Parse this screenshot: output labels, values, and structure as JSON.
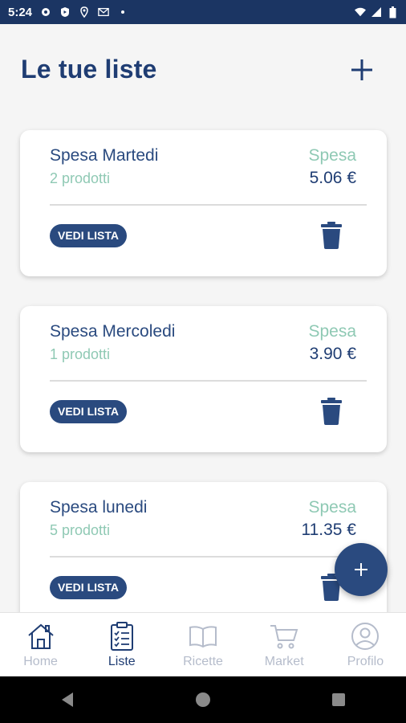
{
  "status_bar": {
    "time": "5:24",
    "icons_left": [
      "gear-icon",
      "shield-icon",
      "location-icon",
      "gmail-icon",
      "dot-icon"
    ],
    "icons_right": [
      "wifi-icon",
      "signal-icon",
      "battery-icon"
    ]
  },
  "header": {
    "title": "Le tue liste",
    "add_icon": "plus-icon"
  },
  "lists": [
    {
      "name": "Spesa Martedi",
      "count": "2 prodotti",
      "category": "Spesa",
      "total": "5.06 €",
      "view_label": "VEDI LISTA"
    },
    {
      "name": "Spesa Mercoledi",
      "count": "1 prodotti",
      "category": "Spesa",
      "total": "3.90 €",
      "view_label": "VEDI LISTA"
    },
    {
      "name": "Spesa lunedi",
      "count": "5 prodotti",
      "category": "Spesa",
      "total": "11.35 €",
      "view_label": "VEDI LISTA"
    }
  ],
  "fab": {
    "icon": "plus-icon"
  },
  "bottom_nav": {
    "items": [
      {
        "label": "Home",
        "icon": "home-icon"
      },
      {
        "label": "Liste",
        "icon": "clipboard-icon",
        "active": true
      },
      {
        "label": "Ricette",
        "icon": "book-icon"
      },
      {
        "label": "Market",
        "icon": "cart-icon"
      },
      {
        "label": "Profilo",
        "icon": "profile-icon"
      }
    ]
  },
  "colors": {
    "primary": "#1f3d73",
    "button": "#2a4a7f",
    "accent_green": "#8fc9b4",
    "inactive": "#b5bccb",
    "status_bar": "#1b3563"
  }
}
